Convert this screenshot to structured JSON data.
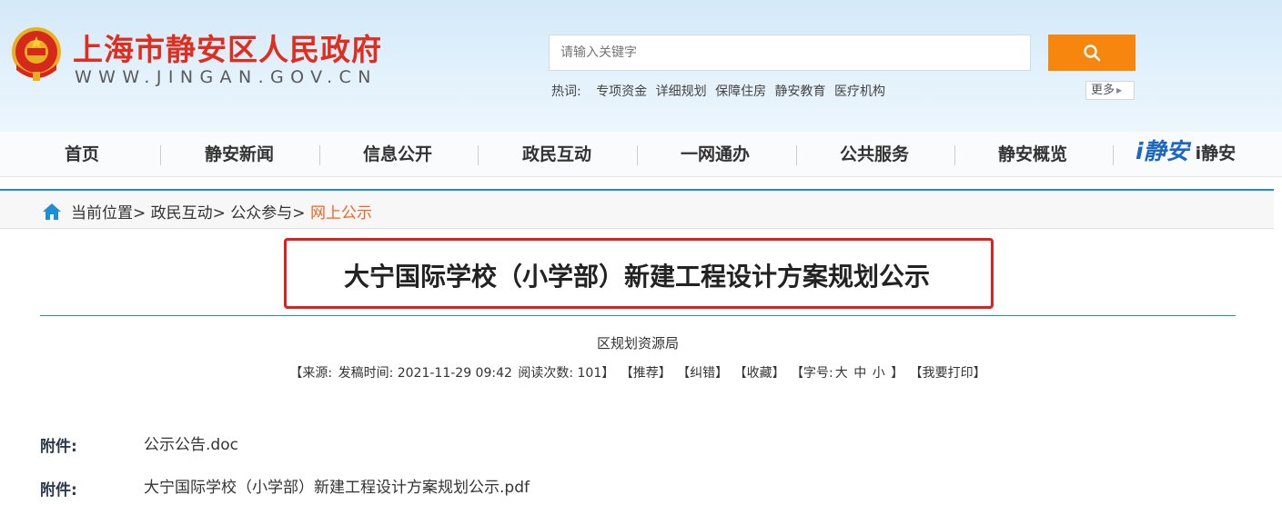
{
  "header": {
    "site_name": "上海市静安区人民政府",
    "site_url": "WWW.JINGAN.GOV.CN",
    "search_placeholder": "请输入关键字",
    "hotwords_label": "热词:",
    "hotwords": [
      "专项资金",
      "详细规划",
      "保障住房",
      "静安教育",
      "医疗机构"
    ],
    "more_label": "更多"
  },
  "nav": {
    "items": [
      "首页",
      "静安新闻",
      "信息公开",
      "政民互动",
      "一网通办",
      "公共服务",
      "静安概览"
    ],
    "ijingan_logo": "i静安",
    "ijingan_text": "i静安"
  },
  "breadcrumb": {
    "prefix": "当前位置>",
    "level1": "政民互动>",
    "level2": "公众参与>",
    "current": "网上公示"
  },
  "article": {
    "title": "大宁国际学校（小学部）新建工程设计方案规划公示",
    "publisher": "区规划资源局",
    "source": "【来源:",
    "publish_time": "发稿时间: 2021-11-29 09:42",
    "views": "阅读次数: 101】",
    "recommend": "【推荐】",
    "correct": "【纠错】",
    "favorite": "【收藏】",
    "fontsize_label": "【字号:",
    "font_large": "大",
    "font_medium": "中",
    "font_small": "小",
    "fontsize_close": "】",
    "print": "【我要打印】"
  },
  "attachments": [
    {
      "label": "附件:",
      "name": "公示公告.doc"
    },
    {
      "label": "附件:",
      "name": "大宁国际学校（小学部）新建工程设计方案规划公示.pdf"
    }
  ],
  "colors": {
    "brand_red": "#df2e1e",
    "search_orange": "#f7860e",
    "accent_blue": "#1d8fd6",
    "highlight_box": "#e02020",
    "breadcrumb_current": "#f26522"
  }
}
